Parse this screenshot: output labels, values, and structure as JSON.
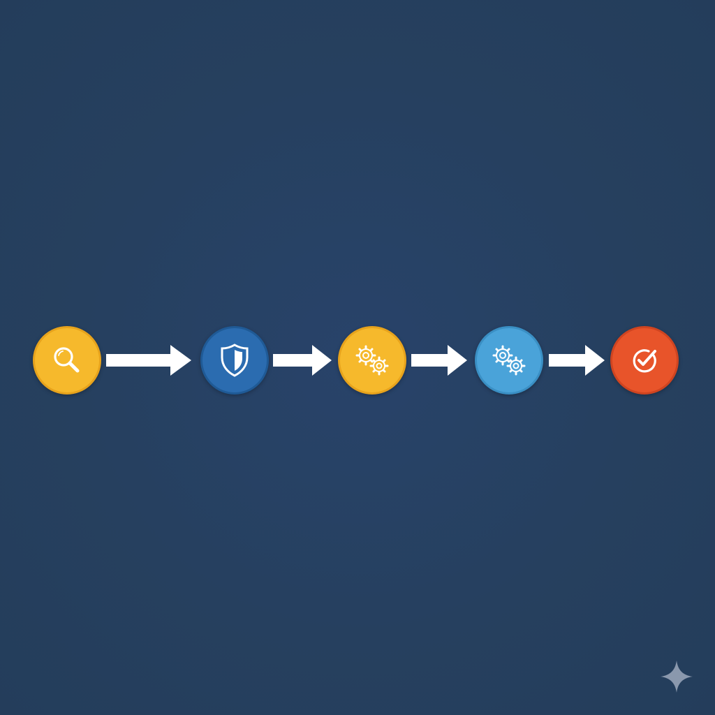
{
  "diagram": {
    "steps": [
      {
        "id": "search",
        "icon": "search-icon",
        "fill": "#f6b92c",
        "ring": "#e7a31c"
      },
      {
        "id": "security",
        "icon": "shield-icon",
        "fill": "#2b6cb0",
        "ring": "#1f5a96"
      },
      {
        "id": "process-yellow",
        "icon": "gears-icon",
        "fill": "#f6b92c",
        "ring": "#e7a31c"
      },
      {
        "id": "process-blue",
        "icon": "gears-icon",
        "fill": "#4aa3d9",
        "ring": "#3a8fc4"
      },
      {
        "id": "complete",
        "icon": "check-circle-icon",
        "fill": "#e8542a",
        "ring": "#cf4420"
      }
    ],
    "arrow_color": "#ffffff",
    "background": "#26405f"
  },
  "watermark": {
    "icon": "sparkle-icon",
    "color": "#8a98ad"
  }
}
